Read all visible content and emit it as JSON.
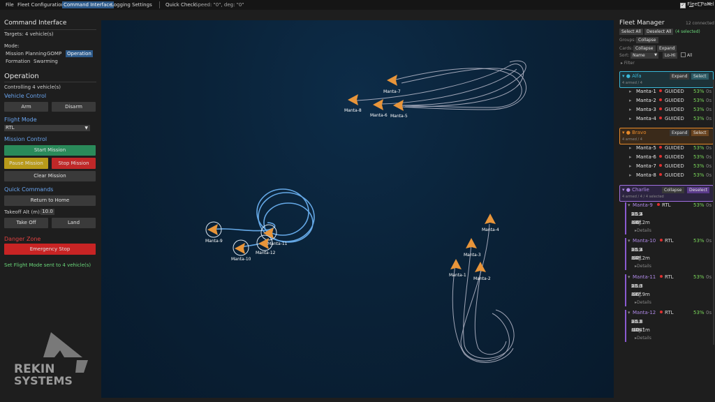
{
  "menu": {
    "items": [
      "File",
      "Fleet Configuration",
      "Command Interface",
      "Logging",
      "Settings"
    ],
    "active_index": 2,
    "quick_check": "Quick Check",
    "speed_text": "Speed: \"0\", deg: \"0\"",
    "fleet_panel_label": "Fleet Panel"
  },
  "left": {
    "title": "Command Interface",
    "targets": "Targets: 4 vehicle(s)",
    "mode_label": "Mode:",
    "modes": [
      "Mission Planning",
      "GOMP",
      "Operation",
      "Formation",
      "Swarming"
    ],
    "selected_mode": "Operation",
    "operation_title": "Operation",
    "controlling": "Controlling 4 vehicle(s)",
    "vehicle_control": "Vehicle Control",
    "arm": "Arm",
    "disarm": "Disarm",
    "flight_mode_hdr": "Flight Mode",
    "flight_mode_value": "RTL",
    "mission_control": "Mission Control",
    "start_mission": "Start Mission",
    "pause_mission": "Pause Mission",
    "stop_mission": "Stop Mission",
    "clear_mission": "Clear Mission",
    "quick_commands": "Quick Commands",
    "return_home": "Return to Home",
    "takeoff_label": "Takeoff Alt (m):",
    "takeoff_value": "10.0",
    "take_off": "Take Off",
    "land": "Land",
    "danger_zone": "Danger Zone",
    "emergency_stop": "Emergency Stop",
    "status": "Set Flight Mode sent to 4 vehicle(s)",
    "logo_top": "REKIN",
    "logo_bottom": "SYSTEMS"
  },
  "map": {
    "labels": [
      "Manta-7",
      "Manta-8",
      "Manta-6",
      "Manta-5",
      "Manta-9",
      "Manta-10",
      "Manta-12",
      "Manta-11",
      "Manta-4",
      "Manta-3",
      "Manta-1",
      "Manta-2"
    ]
  },
  "fleet": {
    "title": "Fleet Manager",
    "connected": "12 connected",
    "select_all": "Select All",
    "deselect_all": "Deselect All",
    "selected_count": "(4 selected)",
    "groups_label": "Groups:",
    "groups_btn": "Collapse",
    "cards_label": "Cards:",
    "cards_collapse": "Collapse",
    "cards_expand": "Expand",
    "sort_label": "Sort:",
    "sort_value": "Name",
    "sort_order": "Lo-Hi",
    "all_label": "All",
    "filter": "Filter",
    "groups": [
      {
        "name": "Alfa",
        "summary": "4 armed / 4",
        "btn1": "Expand",
        "btn2": "Select",
        "color": "#3ab8d8",
        "vehicles": [
          {
            "name": "Manta-1",
            "mode": "GUIDED",
            "batt": "53%",
            "age": "0s"
          },
          {
            "name": "Manta-2",
            "mode": "GUIDED",
            "batt": "53%",
            "age": "0s"
          },
          {
            "name": "Manta-3",
            "mode": "GUIDED",
            "batt": "53%",
            "age": "0s"
          },
          {
            "name": "Manta-4",
            "mode": "GUIDED",
            "batt": "53%",
            "age": "0s"
          }
        ]
      },
      {
        "name": "Bravo",
        "summary": "4 armed / 4",
        "btn1": "Expand",
        "btn2": "Select",
        "color": "#e88a2a",
        "vehicles": [
          {
            "name": "Manta-5",
            "mode": "GUIDED",
            "batt": "53%",
            "age": "0s"
          },
          {
            "name": "Manta-6",
            "mode": "GUIDED",
            "batt": "53%",
            "age": "0s"
          },
          {
            "name": "Manta-7",
            "mode": "GUIDED",
            "batt": "53%",
            "age": "0s"
          },
          {
            "name": "Manta-8",
            "mode": "GUIDED",
            "batt": "53%",
            "age": "0s"
          }
        ]
      },
      {
        "name": "Charlie",
        "summary": "4 armed / 4 / 4 selected",
        "btn1": "Collapse",
        "btn2": "Deselect",
        "color": "#a070e0",
        "cards": [
          {
            "name": "Manta-9",
            "mode": "RTL",
            "batt": "53%",
            "age": "0s",
            "gs": "22.2",
            "as": "21.9",
            "vs": "+0.4",
            "alt": "148.2m",
            "hdg": "-96°",
            "details": "Details"
          },
          {
            "name": "Manta-10",
            "mode": "RTL",
            "batt": "53%",
            "age": "0s",
            "gs": "22.2",
            "as": "21.9",
            "vs": "+0.4",
            "alt": "148.2m",
            "hdg": "-97°",
            "details": "Details"
          },
          {
            "name": "Manta-11",
            "mode": "RTL",
            "batt": "53%",
            "age": "0s",
            "gs": "22.0",
            "as": "21.8",
            "vs": "+0.3",
            "alt": "147.9m",
            "hdg": "-96°",
            "details": "Details"
          },
          {
            "name": "Manta-12",
            "mode": "RTL",
            "batt": "53%",
            "age": "0s",
            "gs": "22.1",
            "as": "21.8",
            "vs": "+0.3",
            "alt": "148.1m",
            "hdg": "-104°",
            "details": "Details"
          }
        ]
      }
    ],
    "field_labels": {
      "gs": "GS",
      "as": "AS",
      "vs": "VS",
      "alt": "Alt",
      "hdg": "Hdg"
    }
  },
  "colors": {
    "accent": "#2d5a8a",
    "link": "#6aa5f0",
    "danger": "#d02828",
    "start": "#2a8a5a",
    "pause": "#b89a1a",
    "batt": "#7ad85a",
    "marker": "#e8953a"
  }
}
